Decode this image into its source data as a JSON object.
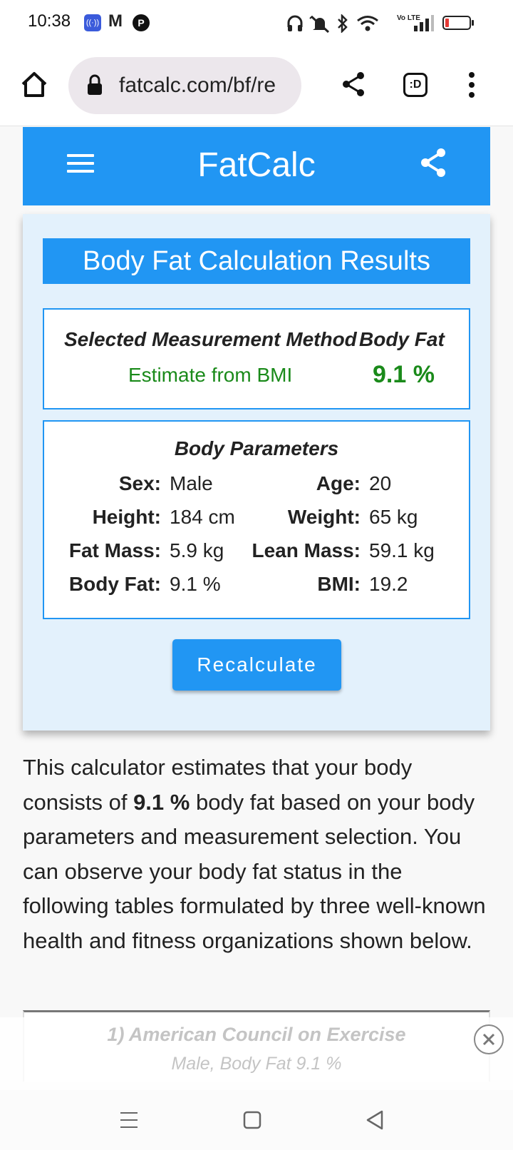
{
  "status_bar": {
    "time": "10:38",
    "notification_icons": [
      "hotspot-icon",
      "gmail-icon",
      "pocket-icon"
    ],
    "system_icons": [
      "headphones-icon",
      "mute-icon",
      "bluetooth-icon",
      "wifi-icon",
      "volte-icon",
      "signal-icon",
      "battery-icon"
    ],
    "volte_label": "Vo LTE",
    "battery_color": "#e53935"
  },
  "browser": {
    "url": "fatcalc.com/bf/re",
    "tab_label": ":D"
  },
  "header": {
    "brand": "FatCalc",
    "color": "#2196f3"
  },
  "results": {
    "title": "Body Fat Calculation Results",
    "method_header": "Selected Measurement Method",
    "bodyfat_header": "Body Fat",
    "method_value": "Estimate from BMI",
    "bodyfat_value": "9.1 %",
    "value_color": "#1a8a1a"
  },
  "params": {
    "title": "Body Parameters",
    "sex_label": "Sex:",
    "sex_value": "Male",
    "age_label": "Age:",
    "age_value": "20",
    "height_label": "Height:",
    "height_value": "184 cm",
    "weight_label": "Weight:",
    "weight_value": "65 kg",
    "fatmass_label": "Fat Mass:",
    "fatmass_value": "5.9 kg",
    "leanmass_label": "Lean Mass:",
    "leanmass_value": "59.1 kg",
    "bodyfat_label": "Body Fat:",
    "bodyfat_value": "9.1 %",
    "bmi_label": "BMI:",
    "bmi_value": "19.2"
  },
  "recalc_label": "Recalculate",
  "description": {
    "part1": "This calculator estimates that your body consists of ",
    "highlight": "9.1 %",
    "part2": " body fat based on your body parameters and measurement selection. You can observe your body fat status in the following tables formulated by three well-known health and fitness organizations shown below."
  },
  "bottom_card": {
    "title": "1) American Council on Exercise",
    "subtitle": "Male, Body Fat 9.1 %"
  }
}
